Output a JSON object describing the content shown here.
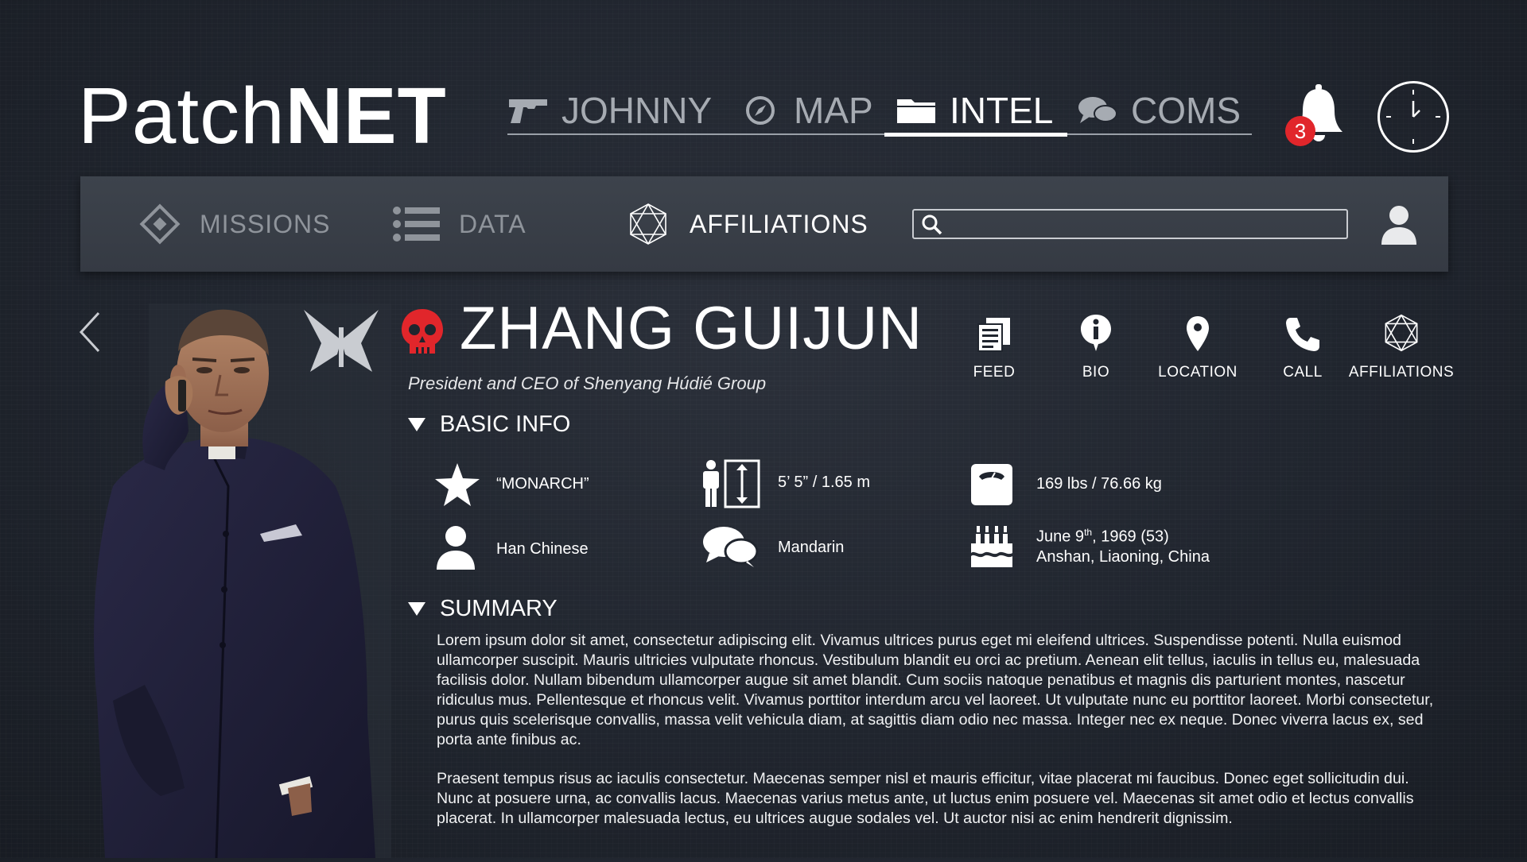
{
  "app": {
    "logo_thin": "Patch",
    "logo_bold": "NET"
  },
  "top_nav": {
    "tabs": [
      {
        "label": "JOHNNY",
        "icon": "pistol-icon"
      },
      {
        "label": "MAP",
        "icon": "compass-icon"
      },
      {
        "label": "INTEL",
        "icon": "folder-icon",
        "active": true
      },
      {
        "label": "COMS",
        "icon": "chat-bubbles-icon"
      }
    ],
    "notification_count": "3"
  },
  "sub_nav": {
    "tabs": [
      {
        "label": "MISSIONS",
        "icon": "diamond-target-icon"
      },
      {
        "label": "DATA",
        "icon": "list-icon"
      },
      {
        "label": "AFFILIATIONS",
        "icon": "network-icon",
        "active": true
      }
    ],
    "search_value": ""
  },
  "profile": {
    "name": "ZHANG GUIJUN",
    "subtitle": "President and CEO of Shenyang Húdié Group",
    "actions": [
      "FEED",
      "BIO",
      "LOCATION",
      "CALL",
      "AFFILIATIONS"
    ]
  },
  "basic_info": {
    "heading": "BASIC INFO",
    "alias": "“MONARCH”",
    "height": "5’ 5” / 1.65 m",
    "weight": "169 lbs / 76.66 kg",
    "ethnicity": "Han Chinese",
    "language": "Mandarin",
    "birth_date_prefix": "June 9",
    "birth_date_suffix": "th",
    "birth_date_rest": ", 1969 (53)",
    "birth_place": "Anshan, Liaoning, China"
  },
  "summary": {
    "heading": "SUMMARY",
    "paragraphs": [
      "Lorem ipsum dolor sit amet, consectetur adipiscing elit. Vivamus ultrices purus eget mi eleifend ultrices. Suspendisse potenti. Nulla euismod ullamcorper suscipit. Mauris ultricies vulputate rhoncus. Vestibulum blandit eu orci ac pretium. Aenean elit tellus, iaculis in tellus eu, malesuada facilisis dolor. Nullam bibendum ullamcorper augue sit amet blandit. Cum sociis natoque penatibus et magnis dis parturient montes, nascetur ridiculus mus. Pellentesque et rhoncus velit. Vivamus porttitor interdum arcu vel laoreet. Ut vulputate nunc eu porttitor laoreet. Morbi consectetur, purus quis scelerisque convallis, massa velit vehicula diam, at sagittis diam odio nec massa. Integer nec ex neque. Donec viverra lacus ex, sed porta ante finibus ac.",
      "Praesent tempus risus ac iaculis consectetur. Maecenas semper nisl et mauris efficitur, vitae placerat mi faucibus. Donec eget sollicitudin dui. Nunc at posuere urna, ac convallis lacus. Maecenas varius metus ante, ut luctus enim posuere vel. Maecenas sit amet odio et lectus convallis placerat. In ullamcorper malesuada lectus, eu ultrices augue sodales vel. Ut auctor nisi ac enim hendrerit dignissim."
    ]
  },
  "colors": {
    "background": "#20252e",
    "toolbar": "#3a3f48",
    "inactive_text": "#a6abb2",
    "active_text": "#ffffff",
    "alert_red": "#e1262b"
  }
}
